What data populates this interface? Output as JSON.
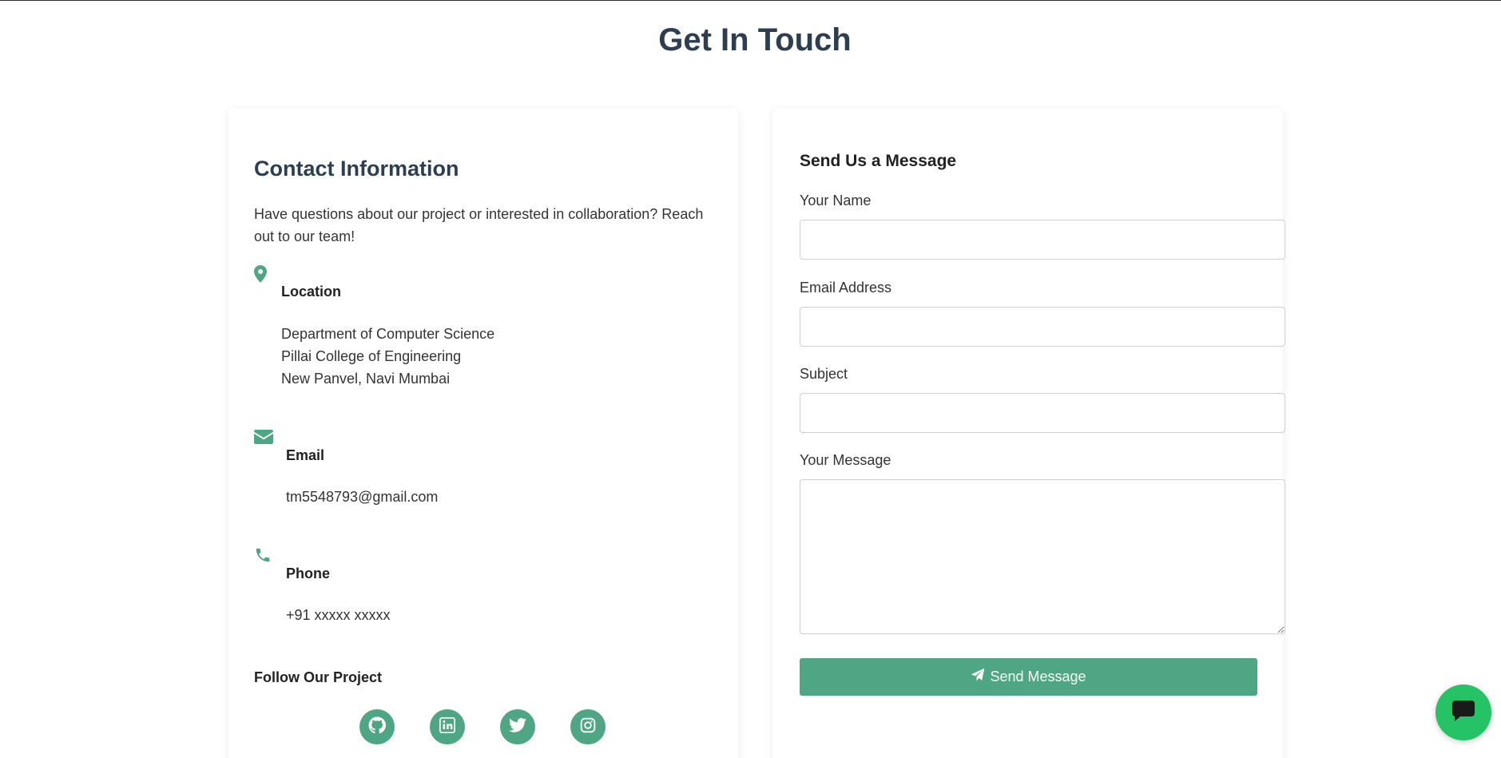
{
  "page": {
    "title": "Get In Touch"
  },
  "contact": {
    "title": "Contact Information",
    "intro": "Have questions about our project or interested in collaboration? Reach out to our team!",
    "location": {
      "heading": "Location",
      "line1": "Department of Computer Science",
      "line2": "Pillai College of Engineering",
      "line3": "New Panvel, Navi Mumbai",
      "icon": "map-marker-icon"
    },
    "email": {
      "heading": "Email",
      "value": "tm5548793@gmail.com",
      "icon": "envelope-icon"
    },
    "phone": {
      "heading": "Phone",
      "value": "+91 xxxxx xxxxx",
      "icon": "phone-icon"
    },
    "follow": {
      "title": "Follow Our Project",
      "links": [
        {
          "icon": "github-icon"
        },
        {
          "icon": "linkedin-icon"
        },
        {
          "icon": "twitter-icon"
        },
        {
          "icon": "instagram-icon"
        }
      ]
    }
  },
  "form": {
    "title": "Send Us a Message",
    "name_label": "Your Name",
    "name_value": "",
    "email_label": "Email Address",
    "email_value": "",
    "subject_label": "Subject",
    "subject_value": "",
    "message_label": "Your Message",
    "message_value": "",
    "submit_label": "Send Message",
    "submit_icon": "paper-plane-icon"
  },
  "chat": {
    "icon": "chat-bubble-icon"
  },
  "colors": {
    "accent": "#4fa684",
    "heading": "#2c3e50",
    "chat": "#25c365"
  }
}
